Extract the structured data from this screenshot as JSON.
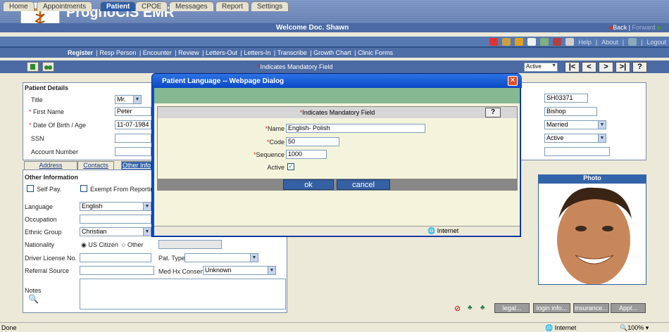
{
  "app": {
    "title": "PrognoCIS EMR",
    "welcome": "Welcome Doc. Shawn",
    "back": "Back",
    "forward": "Forward"
  },
  "tabs": [
    "Home",
    "Appointments",
    "Patient",
    "CPOE",
    "Messages",
    "Report",
    "Settings"
  ],
  "toplinks": {
    "help": "Help",
    "about": "About",
    "logout": "Logout"
  },
  "subnav": [
    "Register",
    "Resp Person",
    "Encounter",
    "Review",
    "Letters-Out",
    "Letters-In",
    "Transcribe",
    "Growth Chart",
    "Clinic Forms"
  ],
  "toolbar": {
    "mandatory_note": "Indicates Mandatory Field",
    "status": "Active",
    "nav": [
      "|<",
      "<",
      ">",
      ">|",
      "?"
    ]
  },
  "patient": {
    "section": "Patient Details",
    "title_label": "Title",
    "title_value": "Mr.",
    "first_name_label": "First Name",
    "first_name": "Peter",
    "dob_label": "Date Of Birth / Age",
    "dob": "11-07-1984",
    "ssn_label": "SSN",
    "account_label": "Account Number",
    "id_value": "SH03371",
    "last_name": "Bishop",
    "marital": "Married",
    "status": "Active"
  },
  "subtabs": [
    "Address",
    "Contacts",
    "Other Info"
  ],
  "other": {
    "section": "Other Information",
    "self_pay": "Self Pay.",
    "exempt": "Exempt From Reporting",
    "language_label": "Language",
    "language": "English",
    "occupation_label": "Occupation",
    "ethnic_label": "Ethnic Group",
    "ethnic": "Christian",
    "nationality_label": "Nationality",
    "us_citizen": "US Citizen",
    "other": "Other",
    "driver_label": "Driver License No.",
    "pat_type_label": "Pat. Type",
    "referral_label": "Referral Source",
    "medhx_label": "Med Hx Consent",
    "medhx": "Unknown",
    "notes_label": "Notes"
  },
  "photo": {
    "title": "Photo"
  },
  "bottom_buttons": [
    "legal...",
    "login info...",
    "insurance...",
    "Appt..."
  ],
  "dialog": {
    "title": "Patient Language -- Webpage Dialog",
    "mandatory_note": "Indicates Mandatory Field",
    "help": "?",
    "name_label": "Name",
    "name": "English- Polish",
    "code_label": "Code",
    "code": "50",
    "sequence_label": "Sequence",
    "sequence": "1000",
    "active_label": "Active",
    "ok": "ok",
    "cancel": "cancel",
    "status": "Internet"
  },
  "statusbar": {
    "left": "Done",
    "zone": "Internet",
    "zoom": "100%"
  }
}
